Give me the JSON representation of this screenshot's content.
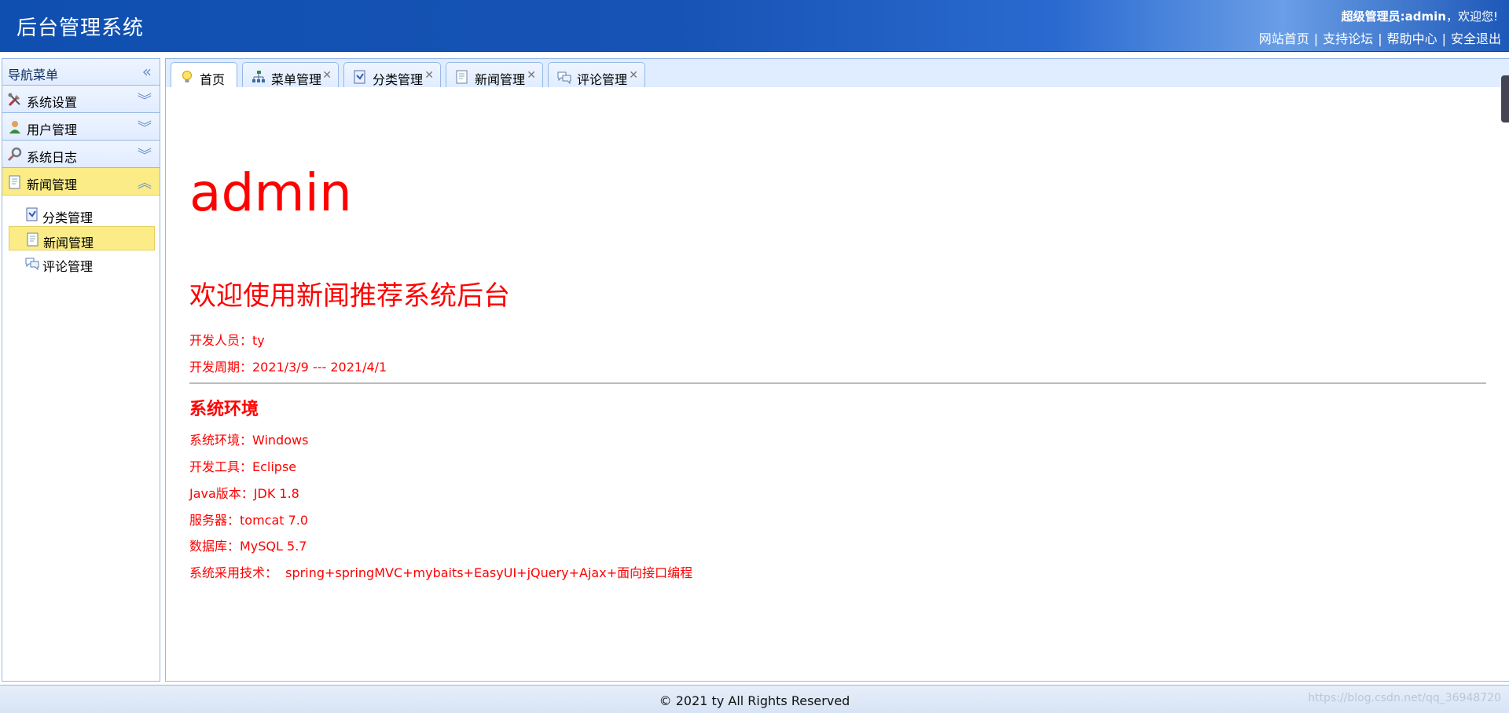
{
  "header": {
    "title": "后台管理系统",
    "welcome_role": "超级管理员:admin",
    "welcome_suffix": "，欢迎您!",
    "links": [
      "网站首页",
      "支持论坛",
      "帮助中心",
      "安全退出"
    ]
  },
  "sidebar": {
    "title": "导航菜单",
    "collapse_glyph": "«",
    "sections": [
      {
        "label": "系统设置",
        "icon": "tools-icon",
        "expanded": false
      },
      {
        "label": "用户管理",
        "icon": "user-icon",
        "expanded": false
      },
      {
        "label": "系统日志",
        "icon": "magnifier-icon",
        "expanded": false
      },
      {
        "label": "新闻管理",
        "icon": "news-icon",
        "expanded": true
      }
    ],
    "sub_items": [
      {
        "label": "分类管理",
        "icon": "category-icon"
      },
      {
        "label": "新闻管理",
        "icon": "news-doc-icon",
        "selected": true
      },
      {
        "label": "评论管理",
        "icon": "comment-icon"
      }
    ]
  },
  "tabs": [
    {
      "label": "首页",
      "icon": "lightbulb-icon",
      "active": true,
      "closable": false
    },
    {
      "label": "菜单管理",
      "icon": "tree-icon",
      "closable": true
    },
    {
      "label": "分类管理",
      "icon": "category-icon",
      "closable": true
    },
    {
      "label": "新闻管理",
      "icon": "news-doc-icon",
      "closable": true
    },
    {
      "label": "评论管理",
      "icon": "comment-icon",
      "closable": true
    }
  ],
  "content": {
    "big_title": "admin",
    "welcome": "欢迎使用新闻推荐系统后台",
    "developer": "开发人员：ty",
    "period": "开发周期：2021/3/9 --- 2021/4/1",
    "env_title": "系统环境",
    "env": [
      "系统环境：Windows",
      "开发工具：Eclipse",
      "Java版本：JDK 1.8",
      "服务器：tomcat 7.0",
      "数据库：MySQL 5.7",
      "系统采用技术：  spring+springMVC+mybaits+EasyUI+jQuery+Ajax+面向接口编程"
    ]
  },
  "footer": {
    "copyright": "© 2021 ty All Rights Reserved",
    "watermark": "https://blog.csdn.net/qq_36948720"
  },
  "colors": {
    "header_blue": "#1753b4",
    "panel_border": "#95b8e7",
    "selected_yellow": "#fbec88",
    "content_red": "#ff0000"
  }
}
